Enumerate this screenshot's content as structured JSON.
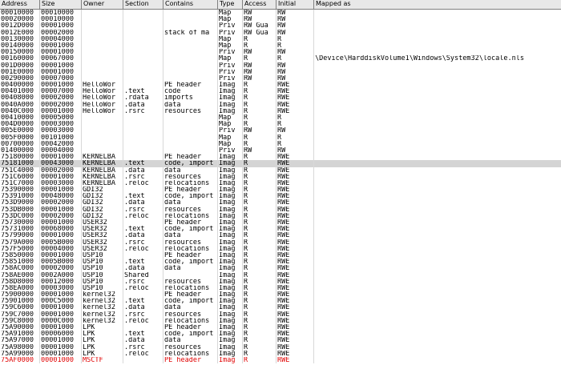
{
  "columns": [
    "Address",
    "Size",
    "Owner",
    "Section",
    "Contains",
    "Type",
    "Access",
    "Initial",
    "Mapped as"
  ],
  "rows": [
    [
      "00010000",
      "00010000",
      "",
      "",
      "",
      "Map",
      "RW",
      "RW",
      ""
    ],
    [
      "00020000",
      "00010000",
      "",
      "",
      "",
      "Map",
      "RW",
      "RW",
      ""
    ],
    [
      "0012D000",
      "00001000",
      "",
      "",
      "",
      "Priv",
      "RW  Gua",
      "RW",
      ""
    ],
    [
      "0012E000",
      "00002000",
      "",
      "",
      "stack of ma",
      "Priv",
      "RW  Gua",
      "RW",
      ""
    ],
    [
      "00130000",
      "00004000",
      "",
      "",
      "",
      "Map",
      "R",
      "R",
      ""
    ],
    [
      "00140000",
      "00001000",
      "",
      "",
      "",
      "Map",
      "R",
      "R",
      ""
    ],
    [
      "00150000",
      "00001000",
      "",
      "",
      "",
      "Priv",
      "RW",
      "RW",
      ""
    ],
    [
      "00160000",
      "00067000",
      "",
      "",
      "",
      "Map",
      "R",
      "R",
      "\\Device\\HarddiskVolume1\\Windows\\System32\\locale.nls"
    ],
    [
      "001D0000",
      "00001000",
      "",
      "",
      "",
      "Priv",
      "RW",
      "RW",
      ""
    ],
    [
      "001E0000",
      "00001000",
      "",
      "",
      "",
      "Priv",
      "RW",
      "RW",
      ""
    ],
    [
      "00290000",
      "00007000",
      "",
      "",
      "",
      "Priv",
      "RW",
      "RW",
      ""
    ],
    [
      "00400000",
      "00001000",
      "HelloWor",
      "",
      "PE header",
      "Imag",
      "R",
      "RWE",
      ""
    ],
    [
      "00401000",
      "00007000",
      "HelloWor",
      ".text",
      "code",
      "Imag",
      "R",
      "RWE",
      ""
    ],
    [
      "00408000",
      "00002000",
      "HelloWor",
      ".rdata",
      "imports",
      "Imag",
      "R",
      "RWE",
      ""
    ],
    [
      "0040A000",
      "00002000",
      "HelloWor",
      ".data",
      "data",
      "Imag",
      "R",
      "RWE",
      ""
    ],
    [
      "0040C000",
      "00001000",
      "HelloWor",
      ".rsrc",
      "resources",
      "Imag",
      "R",
      "RWE",
      ""
    ],
    [
      "00410000",
      "00005000",
      "",
      "",
      "",
      "Map",
      "R",
      "R",
      ""
    ],
    [
      "004D0000",
      "00003000",
      "",
      "",
      "",
      "Map",
      "R",
      "R",
      ""
    ],
    [
      "005E0000",
      "00003000",
      "",
      "",
      "",
      "Priv",
      "RW",
      "RW",
      ""
    ],
    [
      "005F0000",
      "00101000",
      "",
      "",
      "",
      "Map",
      "R",
      "R",
      ""
    ],
    [
      "00700000",
      "00042000",
      "",
      "",
      "",
      "Map",
      "R",
      "R",
      ""
    ],
    [
      "01400000",
      "00004000",
      "",
      "",
      "",
      "Priv",
      "RW",
      "RW",
      ""
    ],
    [
      "75180000",
      "00001000",
      "KERNELBA",
      "",
      "PE header",
      "Imag",
      "R",
      "RWE",
      ""
    ],
    [
      "75181000",
      "00043000",
      "KERNELBA",
      ".text",
      "code, import",
      "Imag",
      "R",
      "RWE",
      ""
    ],
    [
      "751C4000",
      "00002000",
      "KERNELBA",
      ".data",
      "data",
      "Imag",
      "R",
      "RWE",
      ""
    ],
    [
      "751C6000",
      "00001000",
      "KERNELBA",
      ".rsrc",
      "resources",
      "Imag",
      "R",
      "RWE",
      ""
    ],
    [
      "751C7000",
      "00003000",
      "KERNELBA",
      ".reloc",
      "relocations",
      "Imag",
      "R",
      "RWE",
      ""
    ],
    [
      "75390000",
      "00001000",
      "GDI32",
      "",
      "PE header",
      "Imag",
      "R",
      "RWE",
      ""
    ],
    [
      "75391000",
      "00048000",
      "GDI32",
      ".text",
      "code, import",
      "Imag",
      "R",
      "RWE",
      ""
    ],
    [
      "753D9000",
      "00002000",
      "GDI32",
      ".data",
      "data",
      "Imag",
      "R",
      "RWE",
      ""
    ],
    [
      "753DB000",
      "00001000",
      "GDI32",
      ".rsrc",
      "resources",
      "Imag",
      "R",
      "RWE",
      ""
    ],
    [
      "753DC000",
      "00002000",
      "GDI32",
      ".reloc",
      "relocations",
      "Imag",
      "R",
      "RWE",
      ""
    ],
    [
      "75730000",
      "00001000",
      "USER32",
      "",
      "PE header",
      "Imag",
      "R",
      "RWE",
      ""
    ],
    [
      "75731000",
      "00068000",
      "USER32",
      ".text",
      "code, import",
      "Imag",
      "R",
      "RWE",
      ""
    ],
    [
      "75799000",
      "00001000",
      "USER32",
      ".data",
      "data",
      "Imag",
      "R",
      "RWE",
      ""
    ],
    [
      "7579A000",
      "0005B000",
      "USER32",
      ".rsrc",
      "resources",
      "Imag",
      "R",
      "RWE",
      ""
    ],
    [
      "757F5000",
      "00004000",
      "USER32",
      ".reloc",
      "relocations",
      "Imag",
      "R",
      "RWE",
      ""
    ],
    [
      "75850000",
      "00001000",
      "USP10",
      "",
      "PE header",
      "Imag",
      "R",
      "RWE",
      ""
    ],
    [
      "75851000",
      "0005B000",
      "USP10",
      ".text",
      "code, import",
      "Imag",
      "R",
      "RWE",
      ""
    ],
    [
      "758AC000",
      "00002000",
      "USP10",
      ".data",
      "data",
      "Imag",
      "R",
      "RWE",
      ""
    ],
    [
      "758AE000",
      "0002A000",
      "USP10",
      "Shared",
      "",
      "Imag",
      "R",
      "RWE",
      ""
    ],
    [
      "758D8000",
      "00012000",
      "USP10",
      ".rsrc",
      "resources",
      "Imag",
      "R",
      "RWE",
      ""
    ],
    [
      "758EA000",
      "00003000",
      "USP10",
      ".reloc",
      "relocations",
      "Imag",
      "R",
      "RWE",
      ""
    ],
    [
      "75900000",
      "00001000",
      "kernel32",
      "",
      "PE header",
      "Imag",
      "R",
      "RWE",
      ""
    ],
    [
      "75901000",
      "000C5000",
      "kernel32",
      ".text",
      "code, import",
      "Imag",
      "R",
      "RWE",
      ""
    ],
    [
      "759C6000",
      "00001000",
      "kernel32",
      ".data",
      "data",
      "Imag",
      "R",
      "RWE",
      ""
    ],
    [
      "759C7000",
      "00001000",
      "kernel32",
      ".rsrc",
      "resources",
      "Imag",
      "R",
      "RWE",
      ""
    ],
    [
      "759C8000",
      "0000C000",
      "kernel32",
      ".reloc",
      "relocations",
      "Imag",
      "R",
      "RWE",
      ""
    ],
    [
      "75A90000",
      "00001000",
      "LPK",
      "",
      "PE header",
      "Imag",
      "R",
      "RWE",
      ""
    ],
    [
      "75A91000",
      "00006000",
      "LPK",
      ".text",
      "code, import",
      "Imag",
      "R",
      "RWE",
      ""
    ],
    [
      "75A97000",
      "00001000",
      "LPK",
      ".data",
      "data",
      "Imag",
      "R",
      "RWE",
      ""
    ],
    [
      "75A98000",
      "00001000",
      "LPK",
      ".rsrc",
      "resources",
      "Imag",
      "R",
      "RWE",
      ""
    ],
    [
      "75A99000",
      "00001000",
      "LPK",
      ".reloc",
      "relocations",
      "Imag",
      "R",
      "RWE",
      ""
    ],
    [
      "75AF0000",
      "00001000",
      "MSCTF",
      "",
      "PE header",
      "Imag",
      "R",
      "RWE",
      ""
    ]
  ],
  "selected_row": 23,
  "highlight_row": 53,
  "colors": {
    "highlight_text": "#e00000",
    "selected_bg": "#d4d4d4"
  }
}
